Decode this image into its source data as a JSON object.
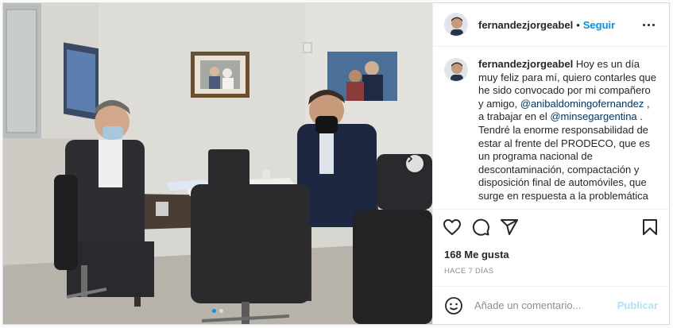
{
  "post": {
    "username": "fernandezjorgeabel",
    "separator": "•",
    "follow_label": "Seguir",
    "caption": {
      "username": "fernandezjorgeabel",
      "text_1": " Hoy es un día muy feliz para mí, quiero contarles que he sido convocado por mi compañero y amigo, ",
      "mention_1": "@anibaldomingofernandez",
      "text_2": " , a trabajar en el ",
      "mention_2": "@minsegargentina",
      "text_3": " . Tendré la enorme responsabilidad de estar al frente del PRODECO, que es un programa nacional de descontaminación, compactación y disposición final de automóviles, que surge en respuesta a la problemática"
    },
    "likes_text": "168 Me gusta",
    "time_text": "HACE 7 DÍAS",
    "comment_placeholder": "Añade un comentario...",
    "publish_label": "Publicar",
    "carousel": {
      "total": 2,
      "current": 1
    }
  },
  "icons": {
    "like": "heart-icon",
    "comment": "comment-icon",
    "share": "paper-plane-icon",
    "save": "bookmark-icon",
    "emoji": "smiley-icon",
    "more": "more-dots-icon",
    "next": "chevron-right-icon"
  },
  "colors": {
    "link_blue": "#0095f6",
    "mention": "#00376b",
    "publish_disabled": "#b2dffc",
    "muted": "#8e8e8e"
  }
}
